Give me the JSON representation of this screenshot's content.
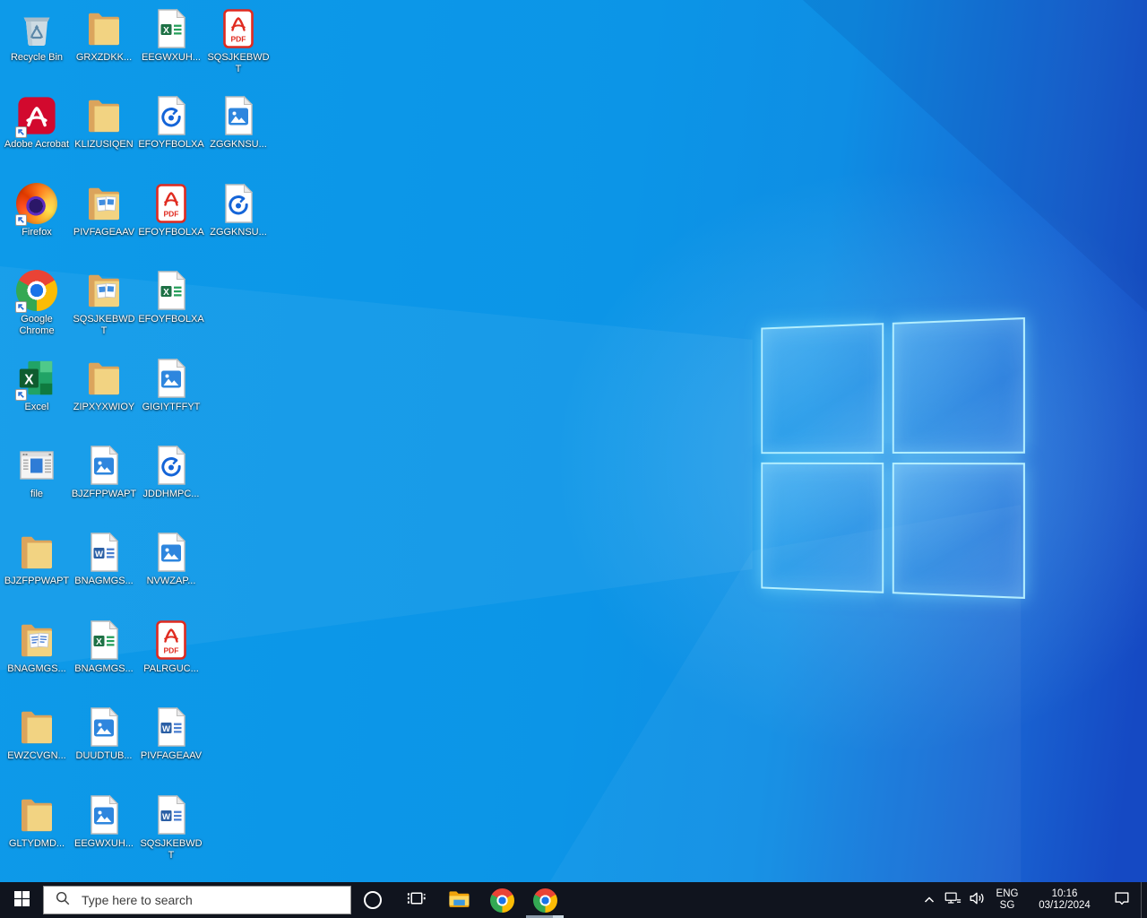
{
  "colors": {
    "wallpaper_azure": "#0c95e7",
    "wallpaper_royal": "#1548c2",
    "logo_glow": "#9fe8ff",
    "taskbar_bg": "#10141e",
    "search_bg": "#ffffff",
    "search_text": "#3c3c3c",
    "active_underline": "#8b99a9"
  },
  "desktop": {
    "icons": [
      {
        "label": "Recycle Bin",
        "type": "recycle-bin",
        "row": 0,
        "col": 0,
        "shortcut": false
      },
      {
        "label": "GRXZDKK...",
        "type": "folder",
        "row": 0,
        "col": 1,
        "shortcut": false
      },
      {
        "label": "EEGWXUH...",
        "type": "excel-file",
        "row": 0,
        "col": 2,
        "shortcut": false
      },
      {
        "label": "SQSJKEBWDT",
        "type": "pdf-file",
        "row": 0,
        "col": 3,
        "shortcut": false
      },
      {
        "label": "Adobe Acrobat",
        "type": "acrobat-app",
        "row": 1,
        "col": 0,
        "shortcut": true
      },
      {
        "label": "KLIZUSIQEN",
        "type": "folder",
        "row": 1,
        "col": 1,
        "shortcut": false
      },
      {
        "label": "EFOYFBOLXA",
        "type": "media-file",
        "row": 1,
        "col": 2,
        "shortcut": false
      },
      {
        "label": "ZGGKNSU...",
        "type": "image-file",
        "row": 1,
        "col": 3,
        "shortcut": false
      },
      {
        "label": "Firefox",
        "type": "firefox-app",
        "row": 2,
        "col": 0,
        "shortcut": true
      },
      {
        "label": "PIVFAGEAAV",
        "type": "folder-images",
        "row": 2,
        "col": 1,
        "shortcut": false
      },
      {
        "label": "EFOYFBOLXA",
        "type": "pdf-file",
        "row": 2,
        "col": 2,
        "shortcut": false
      },
      {
        "label": "ZGGKNSU...",
        "type": "media-file",
        "row": 2,
        "col": 3,
        "shortcut": false
      },
      {
        "label": "Google Chrome",
        "type": "chrome-app",
        "row": 3,
        "col": 0,
        "shortcut": true
      },
      {
        "label": "SQSJKEBWDT",
        "type": "folder-images",
        "row": 3,
        "col": 1,
        "shortcut": false
      },
      {
        "label": "EFOYFBOLXA",
        "type": "excel-file",
        "row": 3,
        "col": 2,
        "shortcut": false
      },
      {
        "label": "Excel",
        "type": "excel-app",
        "row": 4,
        "col": 0,
        "shortcut": true
      },
      {
        "label": "ZIPXYXWIOY",
        "type": "folder",
        "row": 4,
        "col": 1,
        "shortcut": false
      },
      {
        "label": "GIGIYTFFYT",
        "type": "image-file",
        "row": 4,
        "col": 2,
        "shortcut": false
      },
      {
        "label": "file",
        "type": "window-file",
        "row": 5,
        "col": 0,
        "shortcut": false
      },
      {
        "label": "BJZFPPWAPT",
        "type": "image-file",
        "row": 5,
        "col": 1,
        "shortcut": false
      },
      {
        "label": "JDDHMPC...",
        "type": "media-file",
        "row": 5,
        "col": 2,
        "shortcut": false
      },
      {
        "label": "BJZFPPWAPT",
        "type": "folder",
        "row": 6,
        "col": 0,
        "shortcut": false
      },
      {
        "label": "BNAGMGS...",
        "type": "word-file",
        "row": 6,
        "col": 1,
        "shortcut": false
      },
      {
        "label": "NVWZAP...",
        "type": "image-file",
        "row": 6,
        "col": 2,
        "shortcut": false
      },
      {
        "label": "BNAGMGS...",
        "type": "folder-docs",
        "row": 7,
        "col": 0,
        "shortcut": false
      },
      {
        "label": "BNAGMGS...",
        "type": "excel-file",
        "row": 7,
        "col": 1,
        "shortcut": false
      },
      {
        "label": "PALRGUC...",
        "type": "pdf-file",
        "row": 7,
        "col": 2,
        "shortcut": false
      },
      {
        "label": "EWZCVGN...",
        "type": "folder",
        "row": 8,
        "col": 0,
        "shortcut": false
      },
      {
        "label": "DUUDTUB...",
        "type": "image-file",
        "row": 8,
        "col": 1,
        "shortcut": false
      },
      {
        "label": "PIVFAGEAAV",
        "type": "word-file",
        "row": 8,
        "col": 2,
        "shortcut": false
      },
      {
        "label": "GLTYDMD...",
        "type": "folder",
        "row": 9,
        "col": 0,
        "shortcut": false
      },
      {
        "label": "EEGWXUH...",
        "type": "image-file",
        "row": 9,
        "col": 1,
        "shortcut": false
      },
      {
        "label": "SQSJKEBWDT",
        "type": "word-file",
        "row": 9,
        "col": 2,
        "shortcut": false
      }
    ]
  },
  "taskbar": {
    "search": {
      "placeholder": "Type here to search",
      "icon": "search-icon"
    },
    "buttons": [
      {
        "icon": "start-icon"
      },
      {
        "icon": "cortana-icon"
      },
      {
        "icon": "task-view-icon"
      },
      {
        "icon": "file-explorer-icon"
      },
      {
        "icon": "chrome-icon",
        "active": false
      },
      {
        "icon": "chrome-icon",
        "active": true
      }
    ],
    "tray": {
      "hidden_icons_icon": "chevron-up-icon",
      "network_icon": "network-icon",
      "volume_icon": "volume-icon",
      "language": "ENG",
      "region": "SG",
      "time": "10:16",
      "date": "03/12/2024",
      "action_center_icon": "action-center-icon"
    }
  }
}
